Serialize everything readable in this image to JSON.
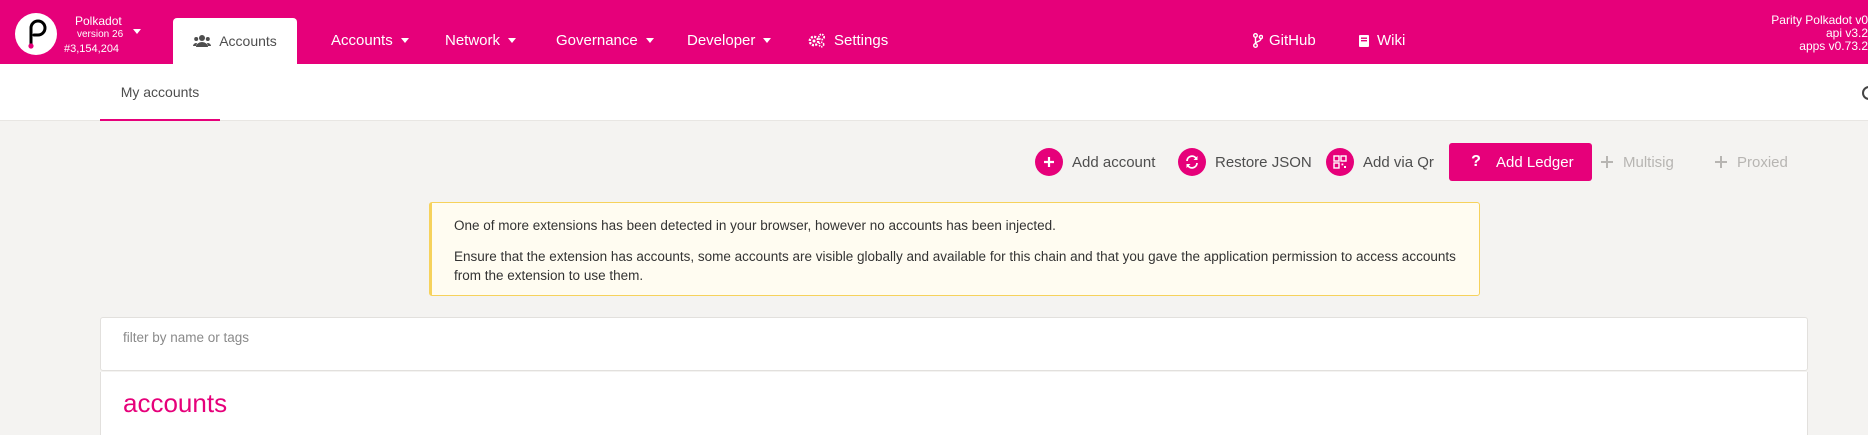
{
  "colors": {
    "accent": "#e6007a",
    "warning_border": "#f6d25c",
    "warning_bg": "#fffcf1"
  },
  "chain": {
    "name": "Polkadot",
    "version": "version 26",
    "block": "#3,154,204"
  },
  "header": {
    "active_tab": "Accounts",
    "nav": [
      {
        "label": "Accounts",
        "dropdown": true
      },
      {
        "label": "Network",
        "dropdown": true
      },
      {
        "label": "Governance",
        "dropdown": true
      },
      {
        "label": "Developer",
        "dropdown": true
      },
      {
        "label": "Settings",
        "icon": "gears-icon"
      }
    ],
    "links": [
      {
        "label": "GitHub",
        "icon": "code-branch-icon"
      },
      {
        "label": "Wiki",
        "icon": "book-icon"
      }
    ],
    "version_lines": [
      "Parity Polkadot v0",
      "api v3.2",
      "apps v0.73.2"
    ]
  },
  "subheader": {
    "tab": "My accounts"
  },
  "actions": {
    "add_account": "Add account",
    "restore_json": "Restore JSON",
    "add_via_qr": "Add via Qr",
    "add_ledger": "Add Ledger",
    "multisig": "Multisig",
    "proxied": "Proxied"
  },
  "warning": {
    "line1": "One of more extensions has been detected in your browser, however no accounts has been injected.",
    "line2": "Ensure that the extension has accounts, some accounts are visible globally and available for this chain and that you gave the application permission to access accounts from the extension to use them."
  },
  "filter": {
    "placeholder": "filter by name or tags"
  },
  "accounts_section": {
    "title": "accounts"
  }
}
